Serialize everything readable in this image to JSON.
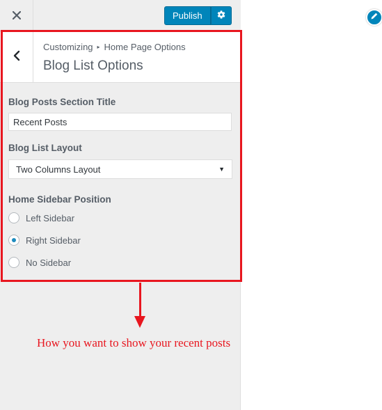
{
  "topbar": {
    "close_icon": "close-icon",
    "publish_label": "Publish",
    "settings_icon": "gear-icon"
  },
  "section_header": {
    "back_icon": "chevron-left-icon",
    "breadcrumb": {
      "root": "Customizing",
      "parent": "Home Page Options"
    },
    "title": "Blog List Options"
  },
  "controls": {
    "section_title_label": "Blog Posts Section Title",
    "section_title_value": "Recent Posts",
    "layout_label": "Blog List Layout",
    "layout_selected": "Two Columns Layout",
    "sidebar_label": "Home Sidebar Position",
    "sidebar_options": [
      {
        "label": "Left Sidebar",
        "checked": false
      },
      {
        "label": "Right Sidebar",
        "checked": true
      },
      {
        "label": "No Sidebar",
        "checked": false
      }
    ]
  },
  "annotation": {
    "text": "How you want to show your recent posts",
    "color": "#e8161f"
  },
  "preview": {
    "edit_icon": "pencil-icon"
  },
  "colors": {
    "accent": "#0085ba",
    "highlight": "#e8161f"
  }
}
